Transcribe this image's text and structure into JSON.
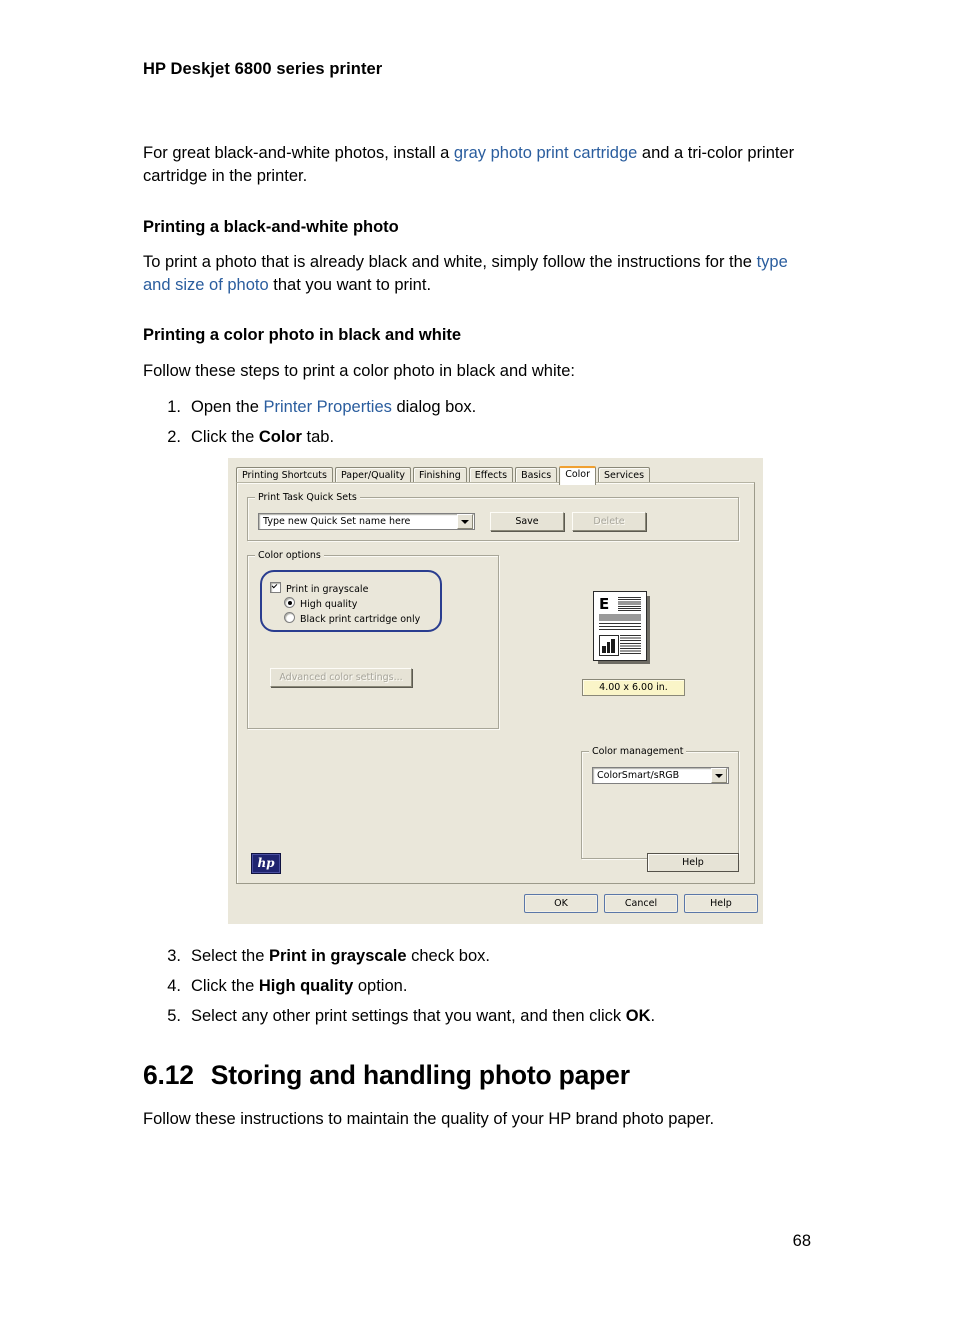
{
  "document": {
    "header": "HP Deskjet 6800 series printer",
    "page_number": "68",
    "intro": {
      "before_link": "For great black-and-white photos, install a ",
      "link": "gray photo print cartridge",
      "after_link": " and a tri-color printer cartridge in the printer."
    },
    "section_bw": {
      "heading": "Printing a black-and-white photo",
      "before_link": "To print a photo that is already black and white, simply follow the instructions for the ",
      "link": "type and size of photo",
      "after_link": " that you want to print."
    },
    "section_color": {
      "heading": "Printing a color photo in black and white",
      "intro": "Follow these steps to print a color photo in black and white:",
      "steps_before": [
        {
          "num": "1.",
          "pre": "Open the ",
          "link": "Printer Properties",
          "post": " dialog box."
        },
        {
          "num": "2.",
          "pre": "Click the ",
          "bold": "Color",
          "post": " tab."
        }
      ],
      "steps_after": [
        {
          "num": "3.",
          "pre": "Select the ",
          "bold": "Print in grayscale",
          "post": " check box."
        },
        {
          "num": "4.",
          "pre": "Click the ",
          "bold": "High quality",
          "post": " option."
        },
        {
          "num": "5.",
          "pre": "Select any other print settings that you want, and then click ",
          "bold": "OK",
          "post": "."
        }
      ]
    },
    "chapter": {
      "number": "6.12",
      "title": "Storing and handling photo paper",
      "body": "Follow these instructions to maintain the quality of your HP brand photo paper."
    }
  },
  "dialog": {
    "tabs": [
      {
        "label": "Printing Shortcuts",
        "active": false
      },
      {
        "label": "Paper/Quality",
        "active": false
      },
      {
        "label": "Finishing",
        "active": false
      },
      {
        "label": "Effects",
        "active": false
      },
      {
        "label": "Basics",
        "active": false
      },
      {
        "label": "Color",
        "active": true
      },
      {
        "label": "Services",
        "active": false
      }
    ],
    "quick_sets": {
      "group_title": "Print Task Quick Sets",
      "combo_value": "Type new Quick Set name here",
      "save_label": "Save",
      "delete_label": "Delete"
    },
    "color_options": {
      "group_title": "Color options",
      "grayscale_label": "Print in grayscale",
      "grayscale_checked": true,
      "high_quality_label": "High quality",
      "high_quality_selected": true,
      "black_cartridge_label": "Black print cartridge only",
      "black_cartridge_selected": false,
      "advanced_button_label": "Advanced color settings..."
    },
    "preview": {
      "page_letter": "E",
      "size_label": "4.00 x 6.00 in."
    },
    "color_management": {
      "group_title": "Color management",
      "combo_value": "ColorSmart/sRGB"
    },
    "brand_logo_text": "hp",
    "inner_help_label": "Help",
    "footer_buttons": {
      "ok": "OK",
      "cancel": "Cancel",
      "help": "Help"
    },
    "colors": {
      "dialog_bg": "#EAE7DA",
      "active_tab_accent": "#f0a030",
      "highlight_outline": "#2a3d8f",
      "size_label_bg": "#FAF5C8",
      "link_blue": "#2a5d9e",
      "hp_logo_bg": "#1f2470"
    }
  }
}
